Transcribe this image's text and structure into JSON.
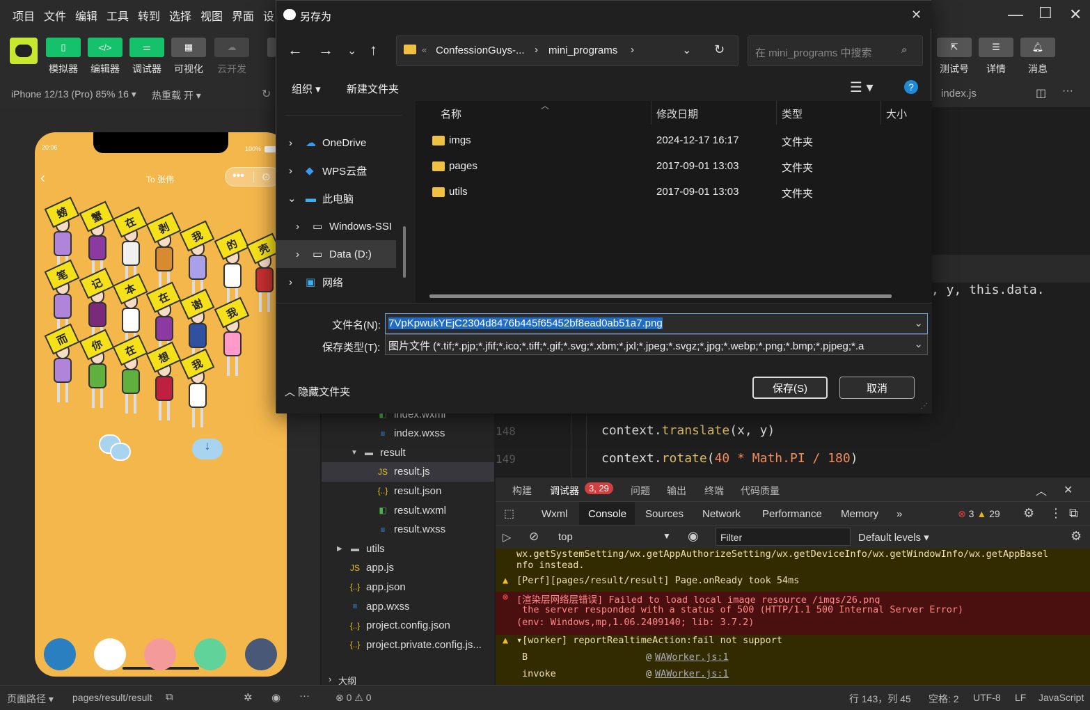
{
  "menu": {
    "items": [
      "项目",
      "文件",
      "编辑",
      "工具",
      "转到",
      "选择",
      "视图",
      "界面",
      "设"
    ]
  },
  "toolbar": {
    "buttons": [
      {
        "label": "模拟器",
        "color": "#15c26b"
      },
      {
        "label": "编辑器",
        "color": "#15c26b"
      },
      {
        "label": "调试器",
        "color": "#15c26b"
      },
      {
        "label": "可视化",
        "color": "#555555"
      },
      {
        "label": "云开发",
        "color": "#444444"
      }
    ],
    "right_buttons": [
      "测试号",
      "详情",
      "消息"
    ]
  },
  "devbar": {
    "device": "iPhone 12/13 (Pro) 85% 16 ▾",
    "hotreload": "热重载 开 ▾"
  },
  "phone": {
    "time": "20:06",
    "battery": "100%",
    "title": "To 张伟",
    "signs": [
      "螃",
      "蟹",
      "在",
      "剥",
      "我",
      "的",
      "壳",
      "笔",
      "记",
      "本",
      "在",
      "谢",
      "我",
      "而",
      "你",
      "在",
      "想",
      "我"
    ],
    "shirt_colors": [
      "#b084d8",
      "#8a3aa0",
      "#f0f0f0",
      "#d88a30",
      "#a8a0e8",
      "#ffffff",
      "#c83030",
      "#b084d8",
      "#7a2a7a",
      "#ffffff",
      "#8a3aa0",
      "#3050a0",
      "#ff9acb",
      "#b084d8",
      "#60b040",
      "#60b040",
      "#c02040",
      "#ffffff"
    ],
    "bottom_colors": [
      "#2a7fc0",
      "#ffffff",
      "#f59a9a",
      "#5fd39a",
      "#4a5878"
    ]
  },
  "dialog": {
    "title": "另存为",
    "path": [
      "ConfessionGuys-...",
      "mini_programs"
    ],
    "search_placeholder": "在 mini_programs 中搜索",
    "organize": "组织 ▾",
    "new_folder": "新建文件夹",
    "nav": [
      "OneDrive",
      "WPS云盘",
      "此电脑",
      "Windows-SSI",
      "Data (D:)",
      "网络"
    ],
    "columns": {
      "name": "名称",
      "modified": "修改日期",
      "type": "类型",
      "size": "大小"
    },
    "files": [
      {
        "name": "imgs",
        "modified": "2024-12-17 16:17",
        "type": "文件夹"
      },
      {
        "name": "pages",
        "modified": "2017-09-01 13:03",
        "type": "文件夹"
      },
      {
        "name": "utils",
        "modified": "2017-09-01 13:03",
        "type": "文件夹"
      }
    ],
    "filename_label": "文件名(N):",
    "filename": "7VpKpwukYEjC2304d8476b445f65452bf8ead0ab51a7.png",
    "filetype_label": "保存类型(T):",
    "filetype": "图片文件 (*.tif;*.pjp;*.jfif;*.ico;*.tiff;*.gif;*.svg;*.xbm;*.jxl;*.jpeg;*.svgz;*.jpg;*.webp;*.png;*.bmp;*.pjpeg;*.a",
    "hide_folders": "隐藏文件夹",
    "save": "保存(S)",
    "cancel": "取消"
  },
  "filetree": {
    "items": [
      {
        "label": "index.wxml",
        "icon": "wxml",
        "indent": 3
      },
      {
        "label": "index.wxss",
        "icon": "wxss",
        "indent": 3
      },
      {
        "label": "result",
        "icon": "folder",
        "indent": 2
      },
      {
        "label": "result.js",
        "icon": "js",
        "indent": 3
      },
      {
        "label": "result.json",
        "icon": "json",
        "indent": 3
      },
      {
        "label": "result.wxml",
        "icon": "wxml",
        "indent": 3
      },
      {
        "label": "result.wxss",
        "icon": "wxss",
        "indent": 3
      },
      {
        "label": "utils",
        "icon": "folder",
        "indent": 1
      },
      {
        "label": "app.js",
        "icon": "js",
        "indent": 1
      },
      {
        "label": "app.json",
        "icon": "json",
        "indent": 1
      },
      {
        "label": "app.wxss",
        "icon": "wxss",
        "indent": 1
      },
      {
        "label": "project.config.json",
        "icon": "json",
        "indent": 1
      },
      {
        "label": "project.private.config.js...",
        "icon": "json",
        "indent": 1
      }
    ],
    "outline": "大纲"
  },
  "editor": {
    "tab": "index.js",
    "line_frag": ", y, this.data.",
    "lines": [
      {
        "num": "148",
        "code": "context.translate(x, y)"
      },
      {
        "num": "149",
        "code": "context.rotate(40 * Math.PI / 180)"
      }
    ]
  },
  "devtools": {
    "tabs": [
      "构建",
      "调试器",
      "问题",
      "输出",
      "终端",
      "代码质量"
    ],
    "badge": "3, 29",
    "console_tabs": [
      "Wxml",
      "Console",
      "Sources",
      "Network",
      "Performance",
      "Memory"
    ],
    "errors": "3",
    "warnings": "29",
    "context": "top",
    "filter_placeholder": "Filter",
    "levels": "Default levels",
    "messages": [
      {
        "kind": "warn",
        "text": "wx.getSystemSetting/wx.getAppAuthorizeSetting/wx.getDeviceInfo/wx.getWindowInfo/wx.getAppBasel"
      },
      {
        "kind": "warn",
        "text": "nfo instead."
      },
      {
        "kind": "warn",
        "text": "[Perf][pages/result/result] Page.onReady took 54ms"
      },
      {
        "kind": "error",
        "text": "[渲染层网络层错误] Failed to load local image resource /imgs/26.png"
      },
      {
        "kind": "error",
        "text": " the server responded with a status of 500 (HTTP/1.1 500 Internal Server Error)"
      },
      {
        "kind": "error",
        "text": "(env: Windows,mp,1.06.2409140; lib: 3.7.2)"
      },
      {
        "kind": "warn",
        "text": "▾[worker] reportRealtimeAction:fail not support"
      },
      {
        "kind": "warn",
        "text": "B"
      },
      {
        "kind": "warn",
        "text": "invoke"
      }
    ],
    "source_link": "WAWorker.js:1"
  },
  "status": {
    "page_path_label": "页面路径 ▾",
    "page_path": "pages/result/result",
    "problems": "⊗ 0 ⚠ 0",
    "position": "行 143，列 45",
    "spaces": "空格: 2",
    "encoding": "UTF-8",
    "eol": "LF",
    "language": "JavaScript"
  }
}
